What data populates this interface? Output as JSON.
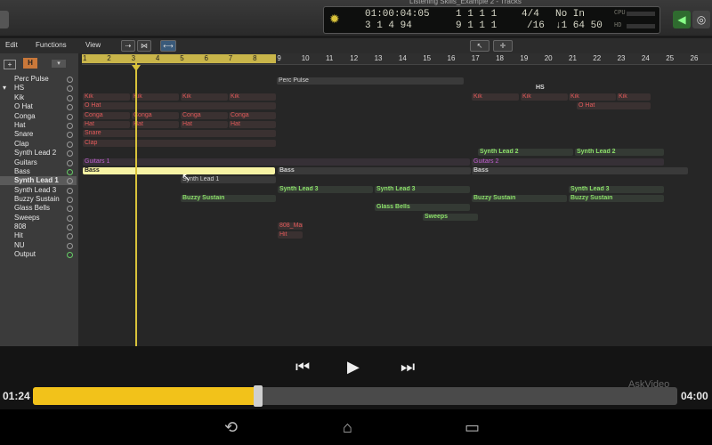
{
  "window_title": "Listening Skills_Example 2 - Tracks",
  "lcd": {
    "time": "01:00:04:05",
    "sub_time": "3 1 4 94",
    "bars": "1  1  1    1",
    "bars2": "9 1 1    1",
    "sig": "4/4",
    "div": "/16",
    "key": "No In",
    "tempo": "↓1 64 50",
    "cpu_label": "CPU",
    "hd_label": "HD"
  },
  "toolbar": {
    "edit": "Edit",
    "functions": "Functions",
    "view": "View"
  },
  "tracks": [
    {
      "name": "Perc Pulse"
    },
    {
      "name": "HS"
    },
    {
      "name": "Kik"
    },
    {
      "name": "O Hat"
    },
    {
      "name": "Conga"
    },
    {
      "name": "Hat"
    },
    {
      "name": "Snare"
    },
    {
      "name": "Clap"
    },
    {
      "name": "Synth Lead 2"
    },
    {
      "name": "Guitars"
    },
    {
      "name": "Bass"
    },
    {
      "name": "Synth Lead 1"
    },
    {
      "name": "Synth Lead 3"
    },
    {
      "name": "Buzzy Sustain"
    },
    {
      "name": "Glass Bells"
    },
    {
      "name": "Sweeps"
    },
    {
      "name": "808"
    },
    {
      "name": "Hit"
    },
    {
      "name": "NU"
    },
    {
      "name": "Output"
    }
  ],
  "ruler": [
    "1",
    "2",
    "3",
    "4",
    "5",
    "6",
    "7",
    "8",
    "9",
    "10",
    "11",
    "12",
    "13",
    "14",
    "15",
    "16",
    "17",
    "18",
    "19",
    "20",
    "21",
    "22",
    "23",
    "24",
    "25",
    "26"
  ],
  "regions": {
    "perc": "Perc Pulse",
    "hs": "HS",
    "kik": "Kik",
    "ohat": "O Hat",
    "conga": "Conga",
    "hat": "Hat",
    "snare": "Snare",
    "clap": "Clap",
    "synth2": "Synth Lead 2",
    "guitars1": "Guitars 1",
    "guitars2": "Guitars 2",
    "bass": "Bass",
    "synth1": "Synth Lead 1",
    "synth3": "Synth Lead 3",
    "buzzy": "Buzzy Sustain",
    "glass": "Glass Bells",
    "sweeps": "Sweeps",
    "mai808": "808_Mai",
    "hit": "Hit"
  },
  "player": {
    "elapsed": "01:24",
    "total": "04:00",
    "progress_fraction": 0.35,
    "watermark": "AskVideo"
  },
  "colors": {
    "accent": "#f2c21a",
    "region_red": "#e05a5a",
    "region_green": "#8ce06a"
  }
}
